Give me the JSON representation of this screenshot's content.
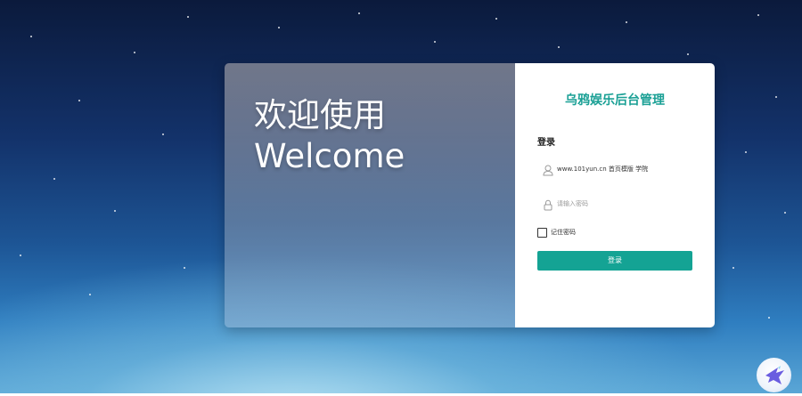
{
  "welcome": {
    "line1": "欢迎使用",
    "line2": "Welcome"
  },
  "login": {
    "title": "乌鸦娱乐后台管理",
    "heading": "登录",
    "username": {
      "value": "www.101yun.cn 首页模版 学院",
      "icon": "user-icon"
    },
    "password": {
      "placeholder": "请输入密码",
      "icon": "lock-icon"
    },
    "remember_label": "记住密码",
    "submit_label": "登录"
  },
  "colors": {
    "accent": "#14a394",
    "title": "#1aa095"
  }
}
